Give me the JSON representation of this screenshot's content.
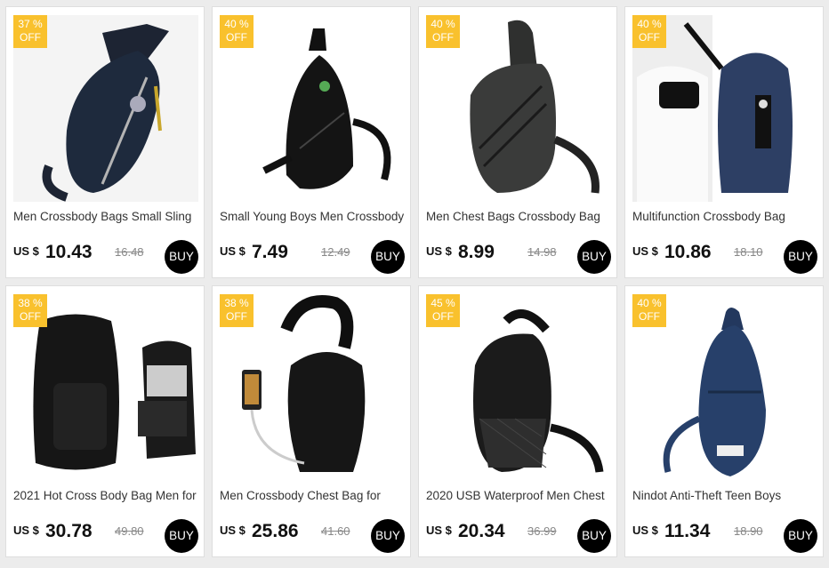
{
  "products": [
    {
      "badge_pct": "37 %",
      "badge_off": "OFF",
      "title": "Men Crossbody Bags Small Sling",
      "currency": "US $",
      "price": "10.43",
      "old_price": "16.48",
      "buy": "BUY"
    },
    {
      "badge_pct": "40 %",
      "badge_off": "OFF",
      "title": "Small Young Boys Men Crossbody",
      "currency": "US $",
      "price": "7.49",
      "old_price": "12.49",
      "buy": "BUY"
    },
    {
      "badge_pct": "40 %",
      "badge_off": "OFF",
      "title": "Men Chest Bags Crossbody Bag",
      "currency": "US $",
      "price": "8.99",
      "old_price": "14.98",
      "buy": "BUY"
    },
    {
      "badge_pct": "40 %",
      "badge_off": "OFF",
      "title": "Multifunction Crossbody Bag",
      "currency": "US $",
      "price": "10.86",
      "old_price": "18.10",
      "buy": "BUY"
    },
    {
      "badge_pct": "38 %",
      "badge_off": "OFF",
      "title": "2021 Hot Cross Body Bag Men for",
      "currency": "US $",
      "price": "30.78",
      "old_price": "49.80",
      "buy": "BUY"
    },
    {
      "badge_pct": "38 %",
      "badge_off": "OFF",
      "title": "Men Crossbody Chest Bag for",
      "currency": "US $",
      "price": "25.86",
      "old_price": "41.60",
      "buy": "BUY"
    },
    {
      "badge_pct": "45 %",
      "badge_off": "OFF",
      "title": "2020 USB Waterproof Men Chest",
      "currency": "US $",
      "price": "20.34",
      "old_price": "36.99",
      "buy": "BUY"
    },
    {
      "badge_pct": "40 %",
      "badge_off": "OFF",
      "title": "Nindot Anti-Theft Teen Boys",
      "currency": "US $",
      "price": "11.34",
      "old_price": "18.90",
      "buy": "BUY"
    }
  ]
}
